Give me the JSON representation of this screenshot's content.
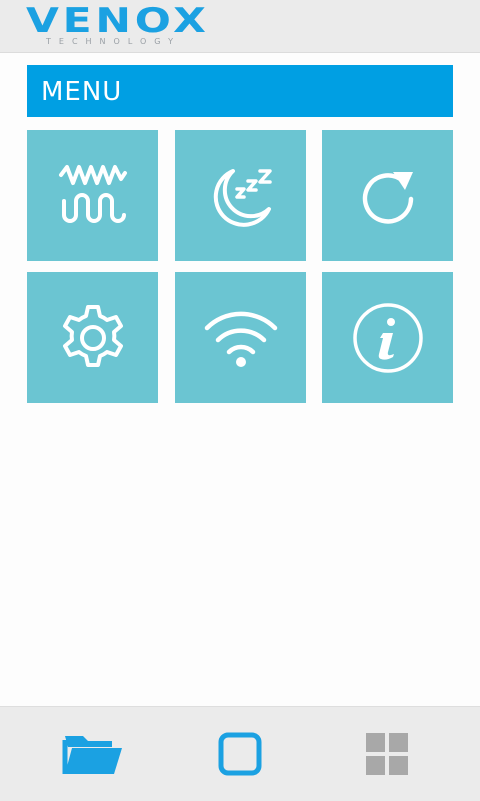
{
  "header": {
    "brand": "VENOX",
    "tagline": "TECHNOLOGY"
  },
  "menu": {
    "title": "MENU"
  },
  "tiles": [
    {
      "icon": "waveform-icon"
    },
    {
      "icon": "sleep-moon-icon"
    },
    {
      "icon": "refresh-icon"
    },
    {
      "icon": "settings-gear-icon"
    },
    {
      "icon": "wifi-icon"
    },
    {
      "icon": "info-icon"
    }
  ],
  "bottom_nav": [
    {
      "icon": "folder-icon"
    },
    {
      "icon": "square-icon"
    },
    {
      "icon": "grid-icon"
    }
  ],
  "colors": {
    "brand": "#1ba1e2",
    "menu_bar": "#009fe3",
    "tile": "#6bc5d2",
    "nav_active": "#1ba1e2",
    "nav_inactive": "#a8a8a8"
  }
}
